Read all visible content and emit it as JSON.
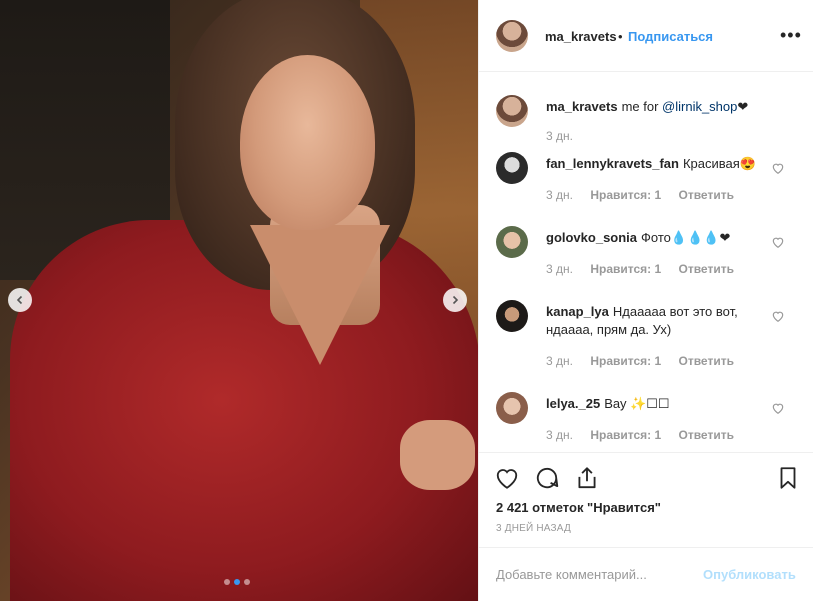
{
  "header": {
    "username": "ma_kravets",
    "separator": "•",
    "follow_label": "Подписаться",
    "more_label": "•••"
  },
  "caption": {
    "username": "ma_kravets",
    "text": "me for",
    "mention": "@lirnik_shop",
    "suffix": "❤",
    "time": "3 дн."
  },
  "comments": [
    {
      "username": "fan_lennykravets_fan",
      "text": "Красивая😍",
      "time": "3 дн.",
      "likes": "Нравится: 1",
      "reply": "Ответить"
    },
    {
      "username": "golovko_sonia",
      "text": "Фото💧💧💧❤",
      "time": "3 дн.",
      "likes": "Нравится: 1",
      "reply": "Ответить"
    },
    {
      "username": "kanap_lya",
      "text": "Ндааааа вот это вот, ндаааа, прям да. Ух)",
      "time": "3 дн.",
      "likes": "Нравится: 1",
      "reply": "Ответить"
    },
    {
      "username": "lelya._25",
      "text": "Вау ✨☐☐",
      "time": "3 дн.",
      "likes": "Нравится: 1",
      "reply": "Ответить"
    }
  ],
  "actions": {
    "icons": [
      "heart-icon",
      "comment-icon",
      "share-icon",
      "bookmark-icon"
    ],
    "likes_text": "2 421 отметок \"Нравится\"",
    "post_time": "3 ДНЕЙ НАЗАД"
  },
  "add_comment": {
    "placeholder": "Добавьте комментарий...",
    "publish_label": "Опубликовать"
  },
  "carousel": {
    "current": 2,
    "total": 3
  },
  "colors": {
    "accent": "#3897f0",
    "muted": "#999999",
    "publish_disabled": "#b2dffc",
    "text": "#262626"
  }
}
